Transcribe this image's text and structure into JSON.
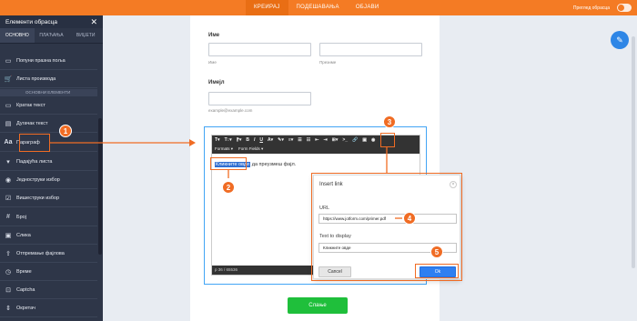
{
  "topbar": {
    "tabs": [
      "КРЕИРАЈ",
      "ПОДЕШАВАЊА",
      "ОБЈАВИ"
    ],
    "preview_label": "Преглед обрасца"
  },
  "sidebar": {
    "title": "Елементи обрасца",
    "tabs": [
      "ОСНОВНО",
      "ПЛАЋАЊА",
      "ВИЏЕТИ"
    ],
    "section_label": "ОСНОВНИ ЕЛЕМЕНТИ",
    "items": [
      {
        "label": "Попуни празна поља",
        "icon": "fill-blank-icon"
      },
      {
        "label": "Листа производа",
        "icon": "cart-icon"
      },
      {
        "label": "Кратак текст",
        "icon": "short-text-icon"
      },
      {
        "label": "Дугачак текст",
        "icon": "long-text-icon"
      },
      {
        "label": "Параграф",
        "icon": "paragraph-icon"
      },
      {
        "label": "Падајућа листа",
        "icon": "dropdown-icon"
      },
      {
        "label": "Једноструки избор",
        "icon": "radio-icon"
      },
      {
        "label": "Вишеструки избор",
        "icon": "checkbox-icon"
      },
      {
        "label": "Број",
        "icon": "number-icon"
      },
      {
        "label": "Слика",
        "icon": "image-icon"
      },
      {
        "label": "Отпремање фајлова",
        "icon": "upload-icon"
      },
      {
        "label": "Време",
        "icon": "clock-icon"
      },
      {
        "label": "Captcha",
        "icon": "captcha-icon"
      },
      {
        "label": "Окретач",
        "icon": "spinner-icon"
      }
    ]
  },
  "form": {
    "name_label": "Име",
    "name_sub1": "Име",
    "name_sub2": "Презиме",
    "email_label": "Имејл",
    "email_sub": "example@example.com",
    "submit_label": "Слање"
  },
  "editor": {
    "toolbar_row2": [
      "Formats ▾",
      "Form Fields ▾"
    ],
    "text_selected": "Кликните овде",
    "text_rest": "да преузмеш фајл.",
    "status": "p  36 / 65536"
  },
  "dialog": {
    "title": "Insert link",
    "url_label": "URL",
    "url_value": "https://www.jotform.com/primer.pdf",
    "text_label": "Text to display",
    "text_value": "Кликните овде",
    "cancel_label": "Cancel",
    "ok_label": "Ok"
  },
  "badges": [
    "1",
    "2",
    "3",
    "4",
    "5"
  ],
  "colors": {
    "accent_orange": "#f47b24",
    "sidebar_bg": "#2e3648",
    "ok_blue": "#2e7ff1",
    "submit_green": "#1fbf3b"
  }
}
